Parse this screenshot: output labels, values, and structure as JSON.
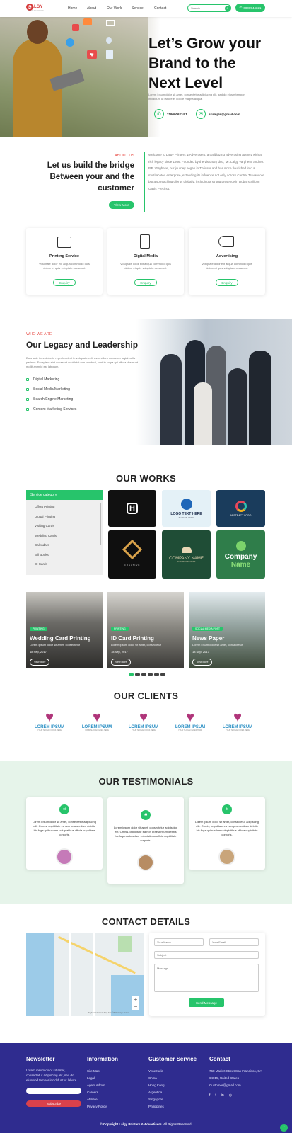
{
  "header": {
    "logo_text": "LALGY",
    "logo_sub": "PRINTS ADVERTISERS",
    "nav": [
      "Home",
      "About",
      "Our Work",
      "Service",
      "Contact"
    ],
    "search_placeholder": "Search",
    "phone": "0000544321"
  },
  "hero": {
    "title_line1": "Let’s Grow your",
    "title_line2": "Brand to the",
    "title_line3": "Next Level",
    "body": "Lorem ipsum dolor sit amet, consectetur adipiscing elit, sed do eiusm tempor incididunt ut labore et dolore magna aliqua.",
    "phone": "2190006234 1",
    "email": "example@gmail.com"
  },
  "about": {
    "eyebrow": "ABOUT US",
    "title": "Let us build the bridge Between your and the customer",
    "button": "View More",
    "body": "Welcome to Lalgy Printers & Advertisers, a trailblazing advertising agency with a rich legacy since 1986. Founded by the visionary duo, Mr. Lalgy Varghese and Mr. P.P. Varghese, our journey began in Thrissur and has since flourished into a multifaceted enterprise, extending its influence not only across Central Travancore but also reaching clients globally, including a strong presence in Dubai's Silicon Oasis Precinct."
  },
  "services": [
    {
      "title": "Printing Service",
      "desc": "Voluptate dolor elit aliqua commodo quis dolore et quis voluptate occaecat.",
      "button": "Enquiry"
    },
    {
      "title": "Digital Media",
      "desc": "Voluptate dolor elit aliqua commodo quis dolore et quis voluptate occaecat.",
      "button": "Enquiry"
    },
    {
      "title": "Advertising",
      "desc": "Voluptate dolor elit aliqua commodo quis dolore et quis voluptate occaecat.",
      "button": "Enquiry"
    }
  ],
  "legacy": {
    "eyebrow": "WHO WE ARE",
    "title": "Our Legacy and Leadership",
    "body": "Duis aute irure dolor in reprehenderit in voluptate velit esse cillum dolore eu fugiat nulla pariatur. Excepteur sint occaecat cupidatat non proident, sunt in culpa qui officia deserunt mollit anim id est laborum.",
    "items": [
      "Digital Marketing",
      "Social Media Marketing",
      "Search Engine Marketing",
      "Content Marketing Services"
    ]
  },
  "works": {
    "title": "OUR WORKS",
    "category_header": "Service category",
    "categories": [
      "Offset Printing",
      "Digital Printing",
      "Visiting Cards",
      "Wedding Cards",
      "Calendars",
      "Bill Books",
      "ID Cards"
    ],
    "tiles": [
      {
        "line1": "",
        "line2": ""
      },
      {
        "line1": "LOGO TEXT HERE",
        "line2": "SLOGAN HERE"
      },
      {
        "line1": "ABSTRACT LOGO",
        "line2": ""
      },
      {
        "line1": "CREATIVE",
        "line2": ""
      },
      {
        "line1": "COMPANY NAME",
        "line2": "SLOGAN GOES HERE"
      },
      {
        "line1": "Company",
        "line2": "Name"
      }
    ],
    "projects": [
      {
        "tag": "PRINTING",
        "title": "Wedding Card Printing",
        "desc": "Lorem ipsum dolor sit amet, consectetur",
        "date": "18 Sep, 2017",
        "button": "View More"
      },
      {
        "tag": "PRINTING",
        "title": "ID Card Printing",
        "desc": "Lorem ipsum dolor sit amet, consectetur",
        "date": "18 Sep, 2017",
        "button": "View More"
      },
      {
        "tag": "SOCIAL MEDIA POST",
        "title": "News Paper",
        "desc": "Lorem ipsum dolor sit amet, consectetur",
        "date": "18 Sep, 2017",
        "button": "View More"
      }
    ]
  },
  "clients": {
    "title": "OUR CLIENTS",
    "logos": [
      {
        "name": "LOREM IPSUM",
        "tagline": "YOUR SLOGAN GOES HERE"
      },
      {
        "name": "LOREM IPSUM",
        "tagline": "YOUR SLOGAN GOES HERE"
      },
      {
        "name": "LOREM IPSUM",
        "tagline": "YOUR SLOGAN GOES HERE"
      },
      {
        "name": "LOREM IPSUM",
        "tagline": "YOUR SLOGAN GOES HERE"
      },
      {
        "name": "LOREM IPSUM",
        "tagline": "YOUR SLOGAN GOES HERE"
      }
    ]
  },
  "testimonials": {
    "title": "OUR TESTIMONIALS",
    "items": [
      "Lorem ipsum dolor sit amet, consectetur adipiscing elit. Omnis, cupiditate ea non praesentium debitis hic fuga quibusdam voluptatibus officia cupiditate corporis.",
      "Lorem ipsum dolor sit amet, consectetur adipiscing elit. Omnis, cupiditate ea non praesentium debitis hic fuga quibusdam voluptatibus officia cupiditate corporis.",
      "Lorem ipsum dolor sit amet, consectetur adipiscing elit. Omnis, cupiditate ea non praesentium debitis hic fuga quibusdam voluptatibus officia cupiditate corporis."
    ]
  },
  "contact": {
    "title": "CONTACT DETAILS",
    "name_placeholder": "Your Name",
    "email_placeholder": "Your Email",
    "subject_placeholder": "Subject",
    "message_placeholder": "Message",
    "button": "Send Message",
    "map_credit": "Keyboard shortcuts   Map data ©2023 Google   Terms"
  },
  "footer": {
    "newsletter_title": "Newsletter",
    "newsletter_body": "Lorem ipsum dolor sit amet, consectetur adipiscing elit, sed do eiusmod tempor incididunt ut labore",
    "subscribe": "Subscribe",
    "info_title": "Information",
    "info_links": [
      "Site Map",
      "Legal",
      "Agent Admin",
      "Careers",
      "Affiliate",
      "Privacy Policy"
    ],
    "cs_title": "Customer Service",
    "cs_links": [
      "Venezuela",
      "China",
      "Hong Kong",
      "Argentina",
      "Singapore",
      "Philippines"
    ],
    "contact_title": "Contact",
    "address": "768 Market Street San Francisco, CA 64015, United States",
    "email": "Customer@gmail.com",
    "copyright_brand": "© Copyright Lalgy Printers & Advertisers",
    "copyright_rest": ". All Rights Reserved."
  },
  "colors": {
    "accent": "#27c46b",
    "footer_bg": "#2f2c8f",
    "eyebrow": "#e8504a"
  }
}
